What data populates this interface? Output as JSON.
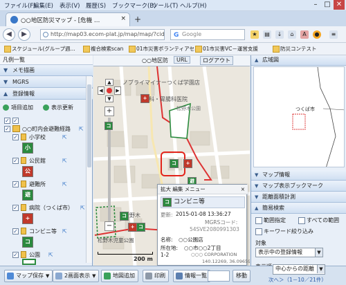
{
  "menu": [
    "ファイル(F)",
    "編集(E)",
    "表示(V)",
    "履歴(S)",
    "ブックマーク(B)",
    "ツール(T)",
    "ヘルプ(H)"
  ],
  "window_controls": {
    "minimize": "–",
    "maximize": "□",
    "close": "✕"
  },
  "tab": {
    "title": "○○地区防災マップ - [危機 …",
    "close": "×",
    "new": "+"
  },
  "nav": {
    "back": "◀",
    "forward": "▶",
    "url": "http://map03.ecom-plat.jp/map/map/?cid=1…",
    "search_placeholder": "Google",
    "search_engine": "G"
  },
  "bookmarks": [
    "スケジュール(グループ週...",
    "複合検索scan",
    "01市災害ボランティアセ...",
    "01市災害VC－運営支援",
    "防災コンテスト"
  ],
  "left_panel": {
    "header": "凡例一覧",
    "sections": [
      "メモ描画",
      "MGRS",
      "登録情報"
    ],
    "add_button": "項目追加",
    "refresh_button": "表示更新",
    "tree": [
      {
        "label": "○○町内会避難経路",
        "level": 0
      },
      {
        "label": "小学校",
        "level": 1,
        "icon": "小",
        "color": "#2b8a3e"
      },
      {
        "label": "公民館",
        "level": 1,
        "icon": "公",
        "color": "#c0392b"
      },
      {
        "label": "避難所",
        "level": 1,
        "icon": "避",
        "color": "#2b8a3e"
      },
      {
        "label": "病院（つくば市）",
        "level": 1,
        "icon": "+",
        "color": "#c0392b"
      },
      {
        "label": "コンビニ等",
        "level": 1,
        "icon": "コ",
        "color": "#2b8a3e"
      },
      {
        "label": "公園",
        "level": 1,
        "icon": "",
        "color": "#7bb661"
      }
    ]
  },
  "map": {
    "toolbar": {
      "layer": "○○地区防",
      "url_btn": "URL",
      "logout": "ログアウト"
    },
    "labels": [
      "ノブライマイナーつくば学園店",
      "内科・胃腸科医院",
      "松野木公園",
      "松野木",
      "松野木児童公園",
      "松野木",
      "つくば市"
    ],
    "scale": "200 m",
    "popup": {
      "menu": "拡大 編集 メニュー",
      "title": "コンビニ等",
      "updated_label": "更新:",
      "updated": "2015-01-08 13:36:27",
      "mgrs_label": "MGRSコード:",
      "mgrs": "54SVE2080991303",
      "name_label": "名称:",
      "name": "○○公園店",
      "addr_label": "所在地:",
      "addr": "○○市○○2丁目",
      "num": "1-2",
      "corp": "○○○ CORPORATION",
      "coord": "140.12269, 36.09659"
    }
  },
  "right_panel": {
    "overview": "広域図",
    "overview_label": "つくば市",
    "sections": [
      "マップ情報",
      "マップ表示ブックマーク",
      "距離面積計測",
      "簡易検索"
    ],
    "range_label": "範囲指定",
    "all_range": "すべての範囲",
    "keyword": "キーワード絞り込み",
    "target_label": "対象",
    "target_value": "表示中の登録情報",
    "order_label": "表示順",
    "order_value": "中心からの距離",
    "paging": "次へ＞（1－10／21件）"
  },
  "bottom": {
    "save": "マップ保存",
    "two_screen": "2画面表示",
    "add_map": "地図追加",
    "print": "印刷",
    "info_list": "情報一覧",
    "move": "移動"
  }
}
